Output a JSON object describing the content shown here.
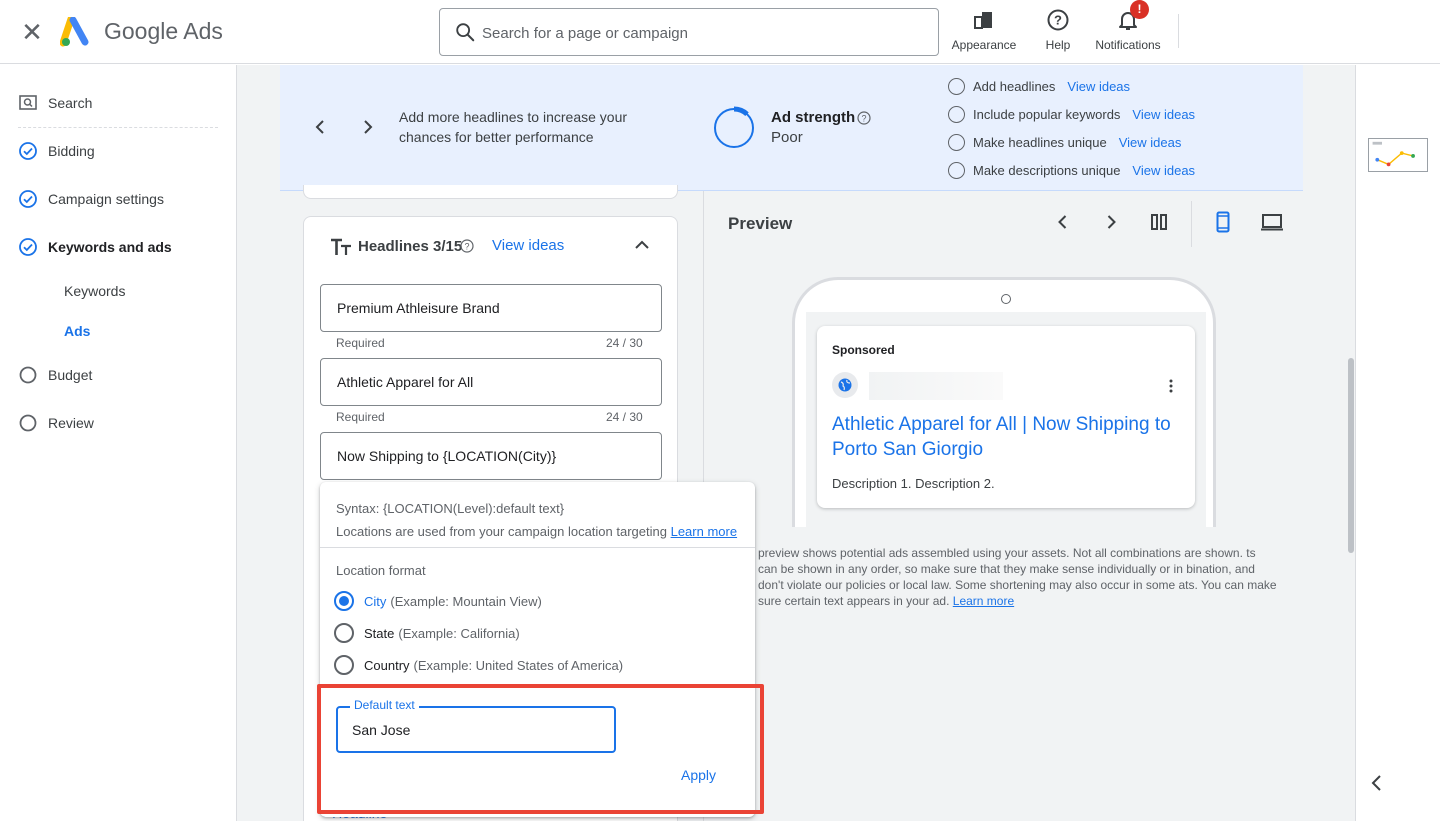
{
  "header": {
    "brand": "Google Ads",
    "search_placeholder": "Search for a page or campaign",
    "appearance_label": "Appearance",
    "help_label": "Help",
    "notifications_label": "Notifications",
    "notification_badge": "!"
  },
  "sidebar": {
    "items": [
      {
        "label": "Search",
        "state": "current-tool"
      },
      {
        "label": "Bidding",
        "state": "complete"
      },
      {
        "label": "Campaign settings",
        "state": "complete"
      },
      {
        "label": "Keywords and ads",
        "state": "active"
      },
      {
        "label": "Budget",
        "state": "incomplete"
      },
      {
        "label": "Review",
        "state": "incomplete"
      }
    ],
    "subitems": [
      {
        "label": "Keywords"
      },
      {
        "label": "Ads",
        "active": true
      }
    ]
  },
  "banner": {
    "message": "Add more headlines to increase your chances for better performance",
    "strength_title": "Ad strength",
    "strength_value": "Poor",
    "strength_fraction": 0.12,
    "suggestions": [
      {
        "text": "Add headlines",
        "link": "View ideas"
      },
      {
        "text": "Include popular keywords",
        "link": "View ideas"
      },
      {
        "text": "Make headlines unique",
        "link": "View ideas"
      },
      {
        "text": "Make descriptions unique",
        "link": "View ideas"
      }
    ]
  },
  "headlines": {
    "title": "Headlines 3/15",
    "view_ideas": "View ideas",
    "fields": [
      {
        "value": "Premium Athleisure Brand",
        "helper": "Required",
        "count": "24 / 30"
      },
      {
        "value": "Athletic Apparel for All",
        "helper": "Required",
        "count": "24 / 30"
      },
      {
        "value": "Now Shipping to {LOCATION(City)}"
      }
    ],
    "add_label": "+ Headline"
  },
  "location_popup": {
    "syntax": "Syntax: {LOCATION(Level):default text}",
    "locations_text": "Locations are used from your campaign location targeting",
    "learn_more": "Learn more",
    "format_label": "Location format",
    "options": [
      {
        "name": "City",
        "example": "(Example: Mountain View)",
        "selected": true
      },
      {
        "name": "State",
        "example": "(Example: California)",
        "selected": false
      },
      {
        "name": "Country",
        "example": "(Example: United States of America)",
        "selected": false
      }
    ],
    "default_label": "Default text",
    "default_value": "San Jose",
    "apply_label": "Apply"
  },
  "preview": {
    "title": "Preview",
    "ad": {
      "sponsored": "Sponsored",
      "headline": "Athletic Apparel for All | Now Shipping to Porto San Giorgio",
      "description": "Description 1. Description 2."
    },
    "note": "preview shows potential ads assembled using your assets. Not all combinations are shown. ts can be shown in any order, so make sure that they make sense individually or in bination, and don't violate our policies or local law. Some shortening may also occur in some ats. You can make sure certain text appears in your ad.",
    "note_link": "Learn more"
  },
  "colors": {
    "accent": "#1a73e8",
    "banner_bg": "#e8f0fe",
    "highlight": "#ea4335",
    "badge": "#d93025"
  }
}
